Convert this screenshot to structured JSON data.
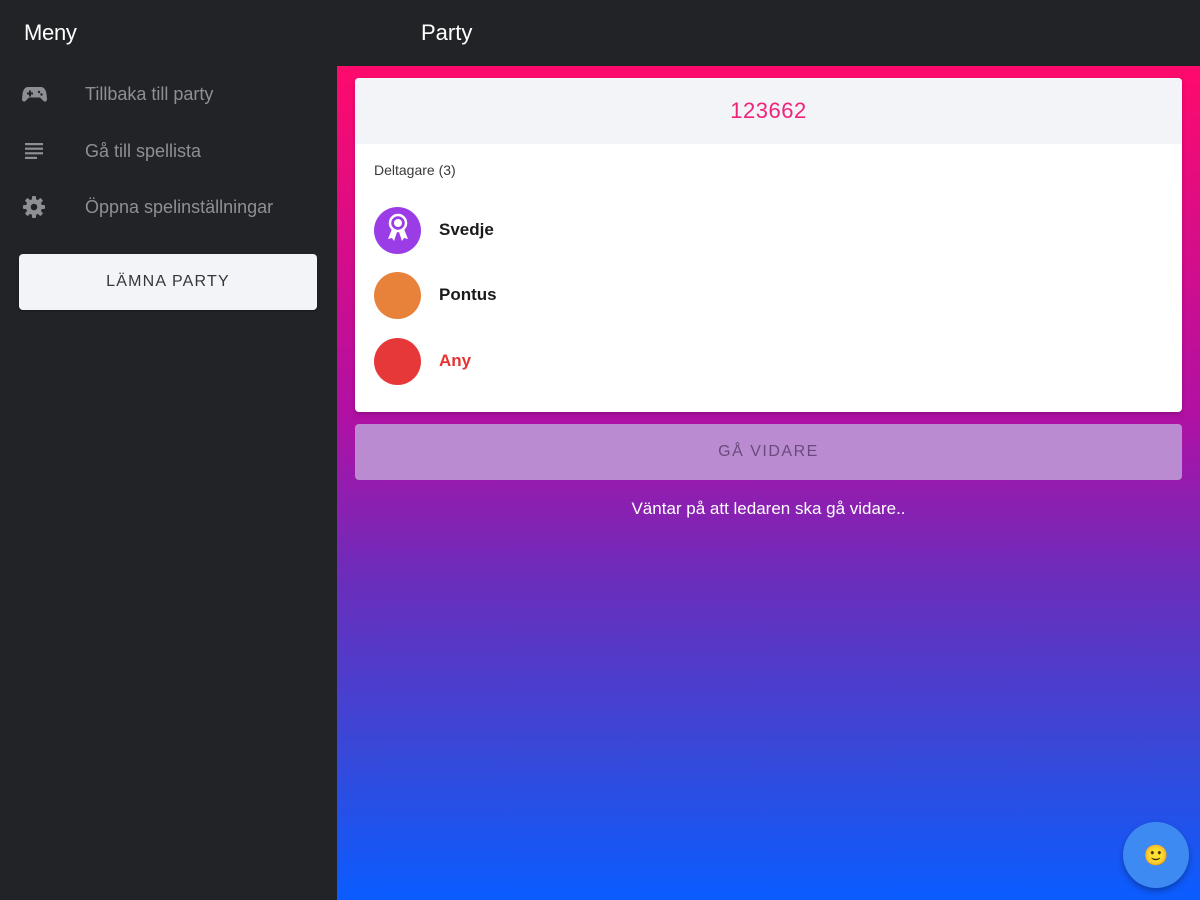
{
  "sidebar": {
    "title": "Meny",
    "items": [
      {
        "label": "Tillbaka till party",
        "icon": "gamepad-icon"
      },
      {
        "label": "Gå till spellista",
        "icon": "list-icon"
      },
      {
        "label": "Öppna spelinställningar",
        "icon": "gear-icon"
      }
    ],
    "leave_button": "LÄMNA PARTY"
  },
  "header": {
    "title": "Party"
  },
  "party": {
    "code": "123662",
    "participants_heading": "Deltagare (3)",
    "participants": [
      {
        "name": "Svedje",
        "color": "#9b3de6",
        "name_color": "#1a1a1a",
        "icon": "leader-badge-icon"
      },
      {
        "name": "Pontus",
        "color": "#e8823a",
        "name_color": "#1a1a1a"
      },
      {
        "name": "Any",
        "color": "#e63838",
        "name_color": "#e63232"
      }
    ]
  },
  "actions": {
    "next_button": "GÅ VIDARE",
    "waiting_text": "Väntar på att ledaren ska gå vidare.."
  },
  "fab": {
    "icon": "emoji-icon",
    "glyph": "🙂"
  },
  "colors": {
    "sidebar_bg": "#222327",
    "code_color": "#f0237a",
    "gradient_top": "#ff0a6c",
    "gradient_bottom": "#0a5cff",
    "fab_bg": "#3d8bf2"
  }
}
